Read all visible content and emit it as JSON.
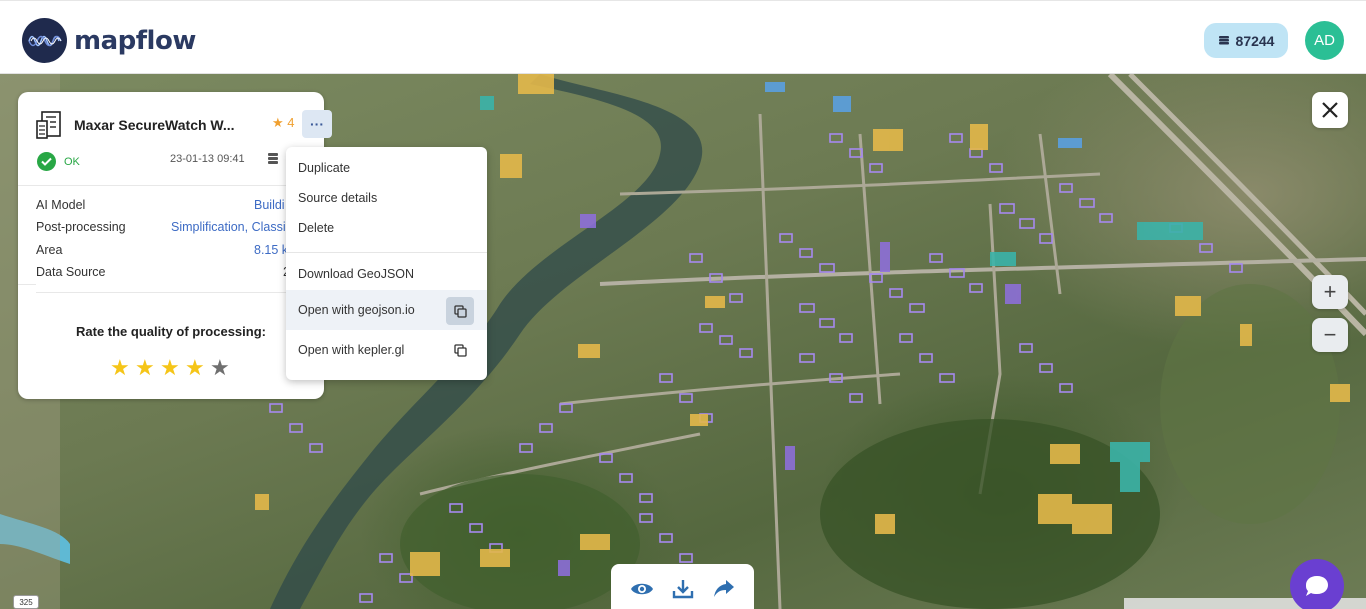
{
  "app": {
    "logo_text": "mapflow",
    "credits": "87244",
    "user_initials": "AD"
  },
  "processing": {
    "title": "Maxar SecureWatch W...",
    "rating": "4",
    "status": "OK",
    "date": "23-01-13 09:41",
    "more_label": "···",
    "details": [
      {
        "label": "AI Model",
        "value": "Buildi"
      },
      {
        "label": "Post-processing",
        "value": "Simplification, Classi"
      },
      {
        "label": "Area",
        "value": "8.15 k"
      },
      {
        "label": "Data Source",
        "value": "2"
      }
    ],
    "rate_prompt": "Rate the quality of processing:",
    "stars_filled": 4,
    "stars_total": 5
  },
  "menu": {
    "items": [
      {
        "label": "Duplicate"
      },
      {
        "label": "Source details"
      },
      {
        "label": "Delete"
      },
      {
        "label": "Download GeoJSON"
      },
      {
        "label": "Open with geojson.io"
      },
      {
        "label": "Open with kepler.gl"
      }
    ]
  },
  "map": {
    "zoom_in": "+",
    "zoom_out": "−",
    "road_shield": "325"
  },
  "colors": {
    "accent": "#3d6bc4",
    "ok": "#28a745",
    "avatar": "#2bbf95",
    "credits_bg": "#bfe4f5",
    "chat": "#6a3fd1",
    "building_purple": "#9b7be0",
    "building_yellow": "#e3b84a",
    "building_teal": "#3bb3a8"
  },
  "icons": [
    "logo-wave-icon",
    "coin-stack-icon",
    "document-icon",
    "star-icon",
    "check-icon",
    "layers-icon",
    "copy-icon",
    "close-icon",
    "eye-icon",
    "download-icon",
    "share-icon",
    "chat-icon"
  ]
}
